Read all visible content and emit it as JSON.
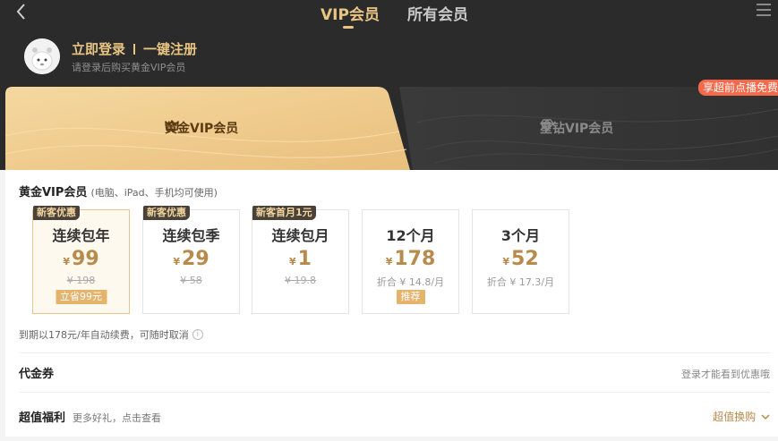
{
  "nav": {
    "tabs": [
      {
        "label": "VIP会员",
        "active": true
      },
      {
        "label": "所有会员",
        "active": false
      }
    ]
  },
  "user": {
    "login_label": "立即登录",
    "register_label": "一键注册",
    "hint": "请登录后购买黄金VIP会员"
  },
  "promo_badge": "享超前点播免费",
  "member_tabs": [
    {
      "label": "黄金VIP会员",
      "icon": "crown-icon"
    },
    {
      "label": "星钻VIP会员",
      "icon": "diamond-icon"
    }
  ],
  "package_section": {
    "title": "黄金VIP会员",
    "note": "(电脑、iPad、手机均可使用)",
    "currency": "¥",
    "cards": [
      {
        "tag": "新客优惠",
        "name": "连续包年",
        "price": "99",
        "original": "¥ 198",
        "badge": "立省99元",
        "selected": true
      },
      {
        "tag": "新客优惠",
        "name": "连续包季",
        "price": "29",
        "original": "¥ 58"
      },
      {
        "tag": "新客首月1元",
        "name": "连续包月",
        "price": "1",
        "original": "¥ 19.8"
      },
      {
        "name": "12个月",
        "price": "178",
        "avg": "折合 ¥ 14.8/月",
        "badge": "推荐"
      },
      {
        "name": "3个月",
        "price": "52",
        "avg": "折合 ¥ 17.3/月"
      }
    ],
    "renew_note": "到期以178元/年自动续费，可随时取消"
  },
  "coupon": {
    "label": "代金券",
    "right": "登录才能看到优惠哦"
  },
  "benefits": {
    "label": "超值福利",
    "sub": "更多好礼，点击查看",
    "right": "超值换购"
  },
  "colors": {
    "header_bg": "#2b2b2b",
    "gold": "#e9c584",
    "price_gold": "#b88a4b",
    "promo_red": "#f5694a"
  }
}
